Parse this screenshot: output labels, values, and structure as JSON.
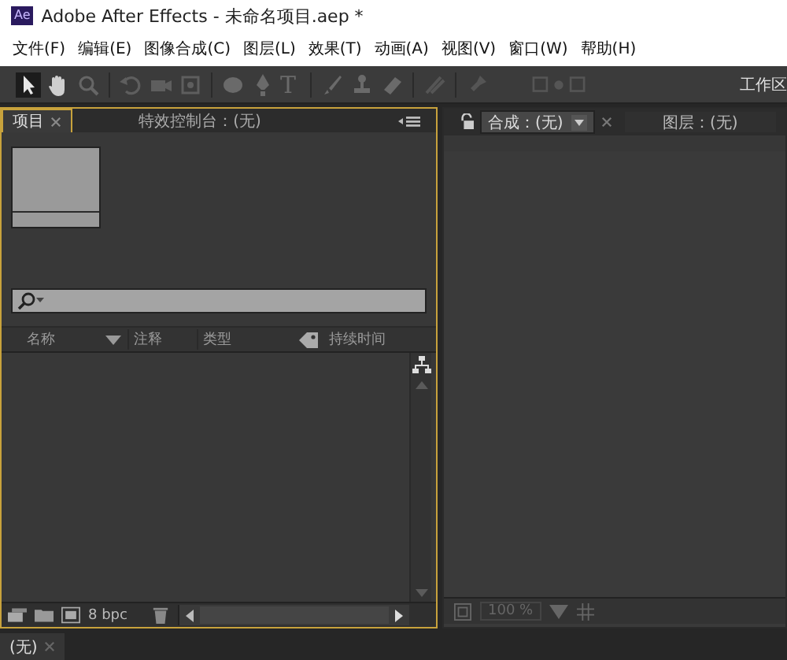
{
  "window": {
    "title": "Adobe After Effects - 未命名项目.aep *",
    "app_badge": "Ae"
  },
  "menu": [
    "文件(F)",
    "编辑(E)",
    "图像合成(C)",
    "图层(L)",
    "效果(T)",
    "动画(A)",
    "视图(V)",
    "窗口(W)",
    "帮助(H)"
  ],
  "toolbar": {
    "text_tool": "T",
    "workspace": "工作区"
  },
  "project_panel": {
    "tabs": [
      {
        "label": "项目",
        "selected": true,
        "closable": true
      },
      {
        "label": "特效控制台：(无)",
        "selected": false,
        "closable": false
      }
    ],
    "columns": [
      "名称",
      "注释",
      "类型",
      "持续时间"
    ],
    "bit_depth": "8 bpc"
  },
  "comp_panel": {
    "tabs": [
      {
        "label": "合成：(无)",
        "selected": true,
        "closable": true,
        "has_menu": true
      },
      {
        "label": "图层：(无)",
        "selected": false,
        "closable": false,
        "has_menu": false
      }
    ],
    "zoom": "100 %"
  },
  "timeline": {
    "tabs": [
      {
        "label": "(无)",
        "selected": true,
        "closable": true
      }
    ]
  }
}
